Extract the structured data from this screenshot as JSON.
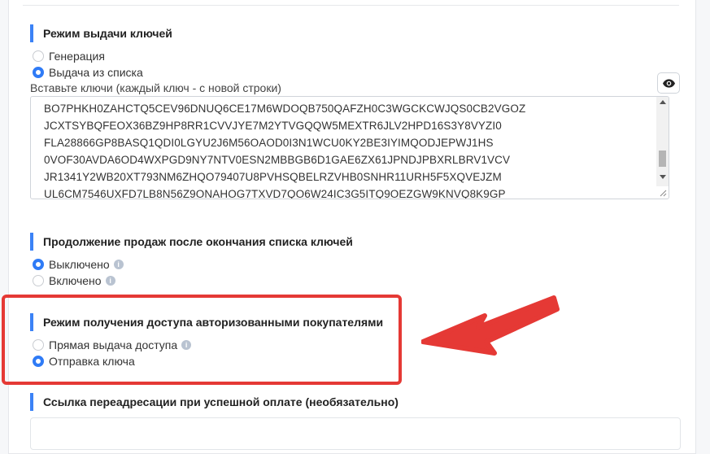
{
  "sections": {
    "key_mode": {
      "title": "Режим выдачи ключей",
      "options": [
        {
          "label": "Генерация",
          "checked": false
        },
        {
          "label": "Выдача из списка",
          "checked": true
        }
      ],
      "keys_hint": "Вставьте ключи (каждый ключ - с новой строки)",
      "toggle_icon": "eye-icon",
      "keys": [
        "BO7PHKH0ZAHCTQ5CEV96DNUQ6CE17M6WDOQB750QAFZH0C3WGCKCWJQS0CB2VGOZ",
        "JCXTSYBQFEOX36BZ9HP8RR1CVVJYE7M2YTVGQQW5MEXTR6JLV2HPD16S3Y8VYZI0",
        "FLA28866GP8BASQ1QDI0LGYU2J6M56OAOD0I3N1WCU0KY2BE3IYIMQODJEPWJ1HS",
        "0VOF30AVDA6OD4WXPGD9NY7NTV0ESN2MBBGB6D1GAE6ZX61JPNDJPBXRLBRV1VCV",
        "JR1341Y2WB20XT793NM6ZHQO79407U8PVHSQBELRZVHB0SNHR11URH5F5XQVEJZM",
        "UL6CM7546UXFD7LB8N56Z9ONAHOG7TXVD7QO6W24IC3G5ITQ9OEZGW9KNVQ8K9GP"
      ]
    },
    "continue_sales": {
      "title": "Продолжение продаж после окончания списка ключей",
      "options": [
        {
          "label": "Выключено",
          "checked": true
        },
        {
          "label": "Включено",
          "checked": false
        }
      ]
    },
    "auth_access": {
      "title": "Режим получения доступа авторизованными покупателями",
      "options": [
        {
          "label": "Прямая выдача доступа",
          "checked": false
        },
        {
          "label": "Отправка ключа",
          "checked": true
        }
      ]
    },
    "redirect": {
      "title": "Ссылка переадресации при успешной оплате (необязательно)",
      "value": ""
    }
  },
  "colors": {
    "accent": "#3b82f6",
    "radio_checked": "#2f7bf6",
    "highlight": "#e53935"
  }
}
